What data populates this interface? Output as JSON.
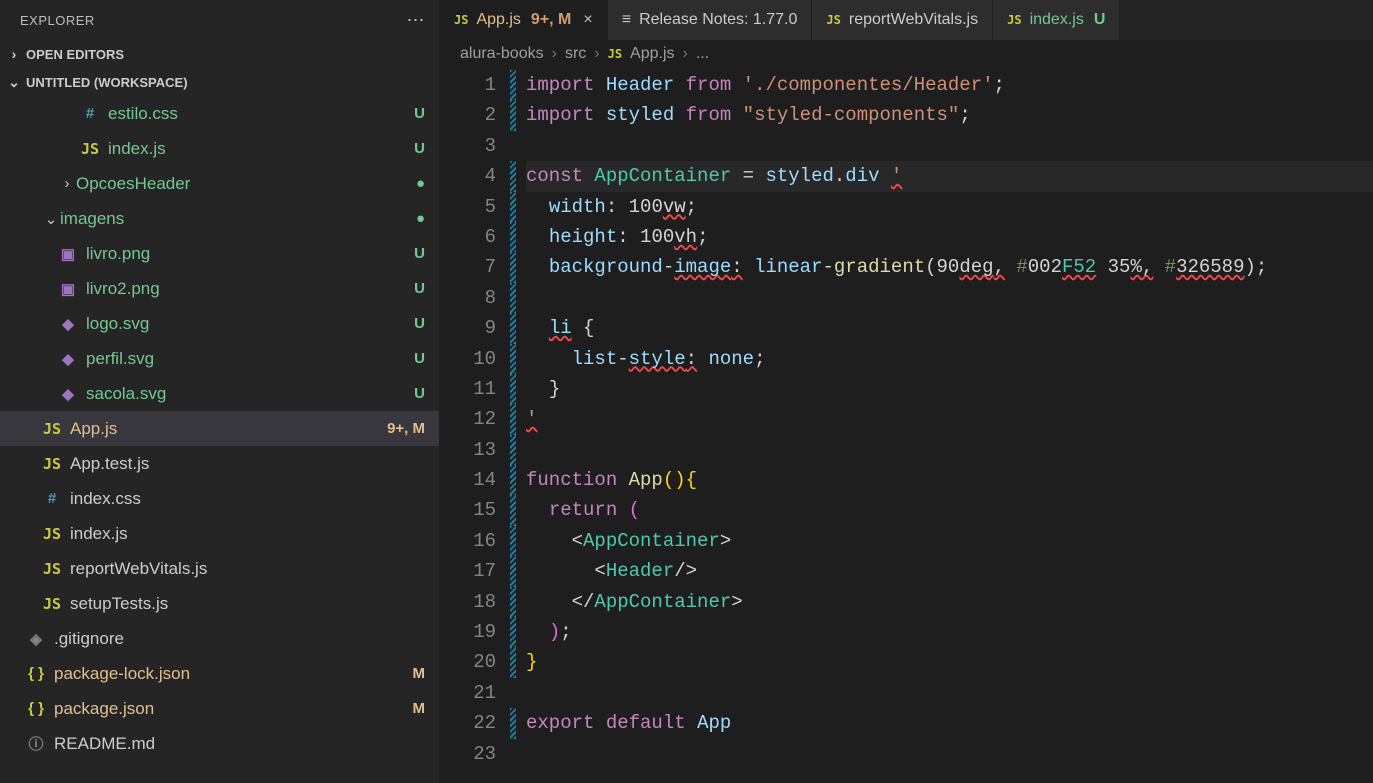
{
  "sidebar": {
    "title": "EXPLORER",
    "open_editors_label": "OPEN EDITORS",
    "workspace_label": "UNTITLED (WORKSPACE)",
    "items": [
      {
        "icon": "hash",
        "label": "estilo.css",
        "indent": 80,
        "status": "U",
        "statusClass": "",
        "color": "green-text"
      },
      {
        "icon": "js",
        "label": "index.js",
        "indent": 80,
        "status": "U",
        "statusClass": "",
        "color": "green-text"
      },
      {
        "icon": "folder-closed",
        "label": "OpcoesHeader",
        "indent": 58,
        "status": "●",
        "statusClass": "bullet",
        "color": "green-text"
      },
      {
        "icon": "folder-open",
        "label": "imagens",
        "indent": 42,
        "status": "●",
        "statusClass": "bullet",
        "color": "green-text"
      },
      {
        "icon": "img",
        "label": "livro.png",
        "indent": 58,
        "status": "U",
        "statusClass": "",
        "color": "green-text"
      },
      {
        "icon": "img",
        "label": "livro2.png",
        "indent": 58,
        "status": "U",
        "statusClass": "",
        "color": "green-text"
      },
      {
        "icon": "svg",
        "label": "logo.svg",
        "indent": 58,
        "status": "U",
        "statusClass": "",
        "color": "green-text"
      },
      {
        "icon": "svg",
        "label": "perfil.svg",
        "indent": 58,
        "status": "U",
        "statusClass": "",
        "color": "green-text"
      },
      {
        "icon": "svg",
        "label": "sacola.svg",
        "indent": 58,
        "status": "U",
        "statusClass": "",
        "color": "green-text"
      },
      {
        "icon": "js",
        "label": "App.js",
        "indent": 42,
        "status": "9+, M",
        "statusClass": "modified",
        "color": "tan-text",
        "active": true
      },
      {
        "icon": "js",
        "label": "App.test.js",
        "indent": 42,
        "status": "",
        "statusClass": "",
        "color": "grey-text"
      },
      {
        "icon": "hash",
        "label": "index.css",
        "indent": 42,
        "status": "",
        "statusClass": "",
        "color": "grey-text"
      },
      {
        "icon": "js",
        "label": "index.js",
        "indent": 42,
        "status": "",
        "statusClass": "",
        "color": "grey-text"
      },
      {
        "icon": "js",
        "label": "reportWebVitals.js",
        "indent": 42,
        "status": "",
        "statusClass": "",
        "color": "grey-text"
      },
      {
        "icon": "js",
        "label": "setupTests.js",
        "indent": 42,
        "status": "",
        "statusClass": "",
        "color": "grey-text"
      },
      {
        "icon": "git",
        "label": ".gitignore",
        "indent": 26,
        "status": "",
        "statusClass": "",
        "color": "grey-text"
      },
      {
        "icon": "json",
        "label": "package-lock.json",
        "indent": 26,
        "status": "M",
        "statusClass": "modified",
        "color": "tan-text"
      },
      {
        "icon": "json",
        "label": "package.json",
        "indent": 26,
        "status": "M",
        "statusClass": "modified",
        "color": "tan-text"
      },
      {
        "icon": "info",
        "label": "README.md",
        "indent": 26,
        "status": "",
        "statusClass": "",
        "color": "grey-text"
      }
    ]
  },
  "tabs": [
    {
      "icon": "js",
      "label": "App.js",
      "modBadge": "9+, M",
      "close": true,
      "active": true,
      "labelColor": "tan-text"
    },
    {
      "icon": "release",
      "label": "Release Notes: 1.77.0",
      "labelColor": "grey-text"
    },
    {
      "icon": "js",
      "label": "reportWebVitals.js",
      "labelColor": "grey-text"
    },
    {
      "icon": "js",
      "label": "index.js",
      "uBadge": "U",
      "labelColor": "green-text"
    }
  ],
  "breadcrumb": {
    "parts": [
      "alura-books",
      "src"
    ],
    "file_icon": "js",
    "file": "App.js",
    "ellipsis": "..."
  },
  "code": {
    "lines": [
      {
        "n": 1,
        "mod": true,
        "html": "<span class='tk-kw'>import</span> <span class='tk-var'>Header</span> <span class='tk-kw'>from</span> <span class='tk-str'>'./componentes/Header'</span><span class='tk-punct'>;</span>"
      },
      {
        "n": 2,
        "mod": true,
        "html": "<span class='tk-kw'>import</span> <span class='tk-var'>styled</span> <span class='tk-kw'>from</span> <span class='tk-str'>\"styled-components\"</span><span class='tk-punct'>;</span>"
      },
      {
        "n": 3,
        "mod": false,
        "html": ""
      },
      {
        "n": 4,
        "mod": true,
        "hl": true,
        "html": "<span class='tk-kw'>const</span> <span class='tk-type'>AppContainer</span> <span class='tk-punct'>=</span> <span class='tk-var'>styled</span><span class='tk-punct'>.</span><span class='tk-var'>div</span> <span class='tk-str squiggle'>'</span>"
      },
      {
        "n": 5,
        "mod": true,
        "html": "  <span class='tk-var'>width</span><span class='tk-punct'>:</span> <span class='tk-white'>100</span><span class='tk-white squiggle'>vw</span><span class='tk-punct'>;</span>"
      },
      {
        "n": 6,
        "mod": true,
        "html": "  <span class='tk-var'>height</span><span class='tk-punct'>:</span> <span class='tk-white'>100</span><span class='tk-white squiggle'>vh</span><span class='tk-punct'>;</span>"
      },
      {
        "n": 7,
        "mod": true,
        "html": "  <span class='tk-var'>background</span><span class='tk-punct'>-</span><span class='tk-var squiggle'>image</span><span class='tk-punct squiggle'>:</span> <span class='tk-var'>linear</span><span class='tk-punct'>-</span><span class='tk-fn'>gradient</span><span class='tk-punct'>(</span><span class='tk-white'>90</span><span class='tk-white squiggle'>deg</span><span class='tk-punct squiggle'>,</span> <span class='tk-comment'>#</span><span class='tk-white'>002</span><span class='tk-type squiggle'>F52</span> <span class='tk-white'>35</span><span class='tk-punct squiggle'>%,</span> <span class='tk-comment'>#</span><span class='tk-white squiggle'>326589</span><span class='tk-punct'>);</span>"
      },
      {
        "n": 8,
        "mod": true,
        "html": ""
      },
      {
        "n": 9,
        "mod": true,
        "html": "  <span class='tk-var squiggle'>li</span> <span class='tk-punct'>{</span>"
      },
      {
        "n": 10,
        "mod": true,
        "html": "    <span class='tk-var'>list</span><span class='tk-punct'>-</span><span class='tk-var squiggle'>style</span><span class='tk-punct squiggle'>:</span> <span class='tk-var'>none</span><span class='tk-punct'>;</span>"
      },
      {
        "n": 11,
        "mod": true,
        "html": "  <span class='tk-punct'>}</span>"
      },
      {
        "n": 12,
        "mod": true,
        "html": "<span class='tk-str squiggle'>'</span>"
      },
      {
        "n": 13,
        "mod": true,
        "html": ""
      },
      {
        "n": 14,
        "mod": true,
        "html": "<span class='tk-kw'>function</span> <span class='tk-fn'>App</span><span class='tk-brace'>()</span><span class='tk-brace'>{</span>"
      },
      {
        "n": 15,
        "mod": true,
        "html": "  <span class='tk-kw'>return</span> <span class='tk-brace2'>(</span>"
      },
      {
        "n": 16,
        "mod": true,
        "html": "    <span class='tk-punct'>&lt;</span><span class='tk-type'>AppContainer</span><span class='tk-punct'>&gt;</span>"
      },
      {
        "n": 17,
        "mod": true,
        "html": "      <span class='tk-punct'>&lt;</span><span class='tk-type'>Header</span><span class='tk-punct'>/&gt;</span>"
      },
      {
        "n": 18,
        "mod": true,
        "html": "    <span class='tk-punct'>&lt;/</span><span class='tk-type'>AppContainer</span><span class='tk-punct'>&gt;</span>"
      },
      {
        "n": 19,
        "mod": true,
        "html": "  <span class='tk-brace2'>)</span><span class='tk-punct'>;</span>"
      },
      {
        "n": 20,
        "mod": true,
        "html": "<span class='tk-brace'>}</span>"
      },
      {
        "n": 21,
        "mod": false,
        "html": ""
      },
      {
        "n": 22,
        "mod": true,
        "html": "<span class='tk-kw'>export</span> <span class='tk-kw'>default</span> <span class='tk-var'>App</span>"
      },
      {
        "n": 23,
        "mod": false,
        "html": ""
      }
    ]
  }
}
